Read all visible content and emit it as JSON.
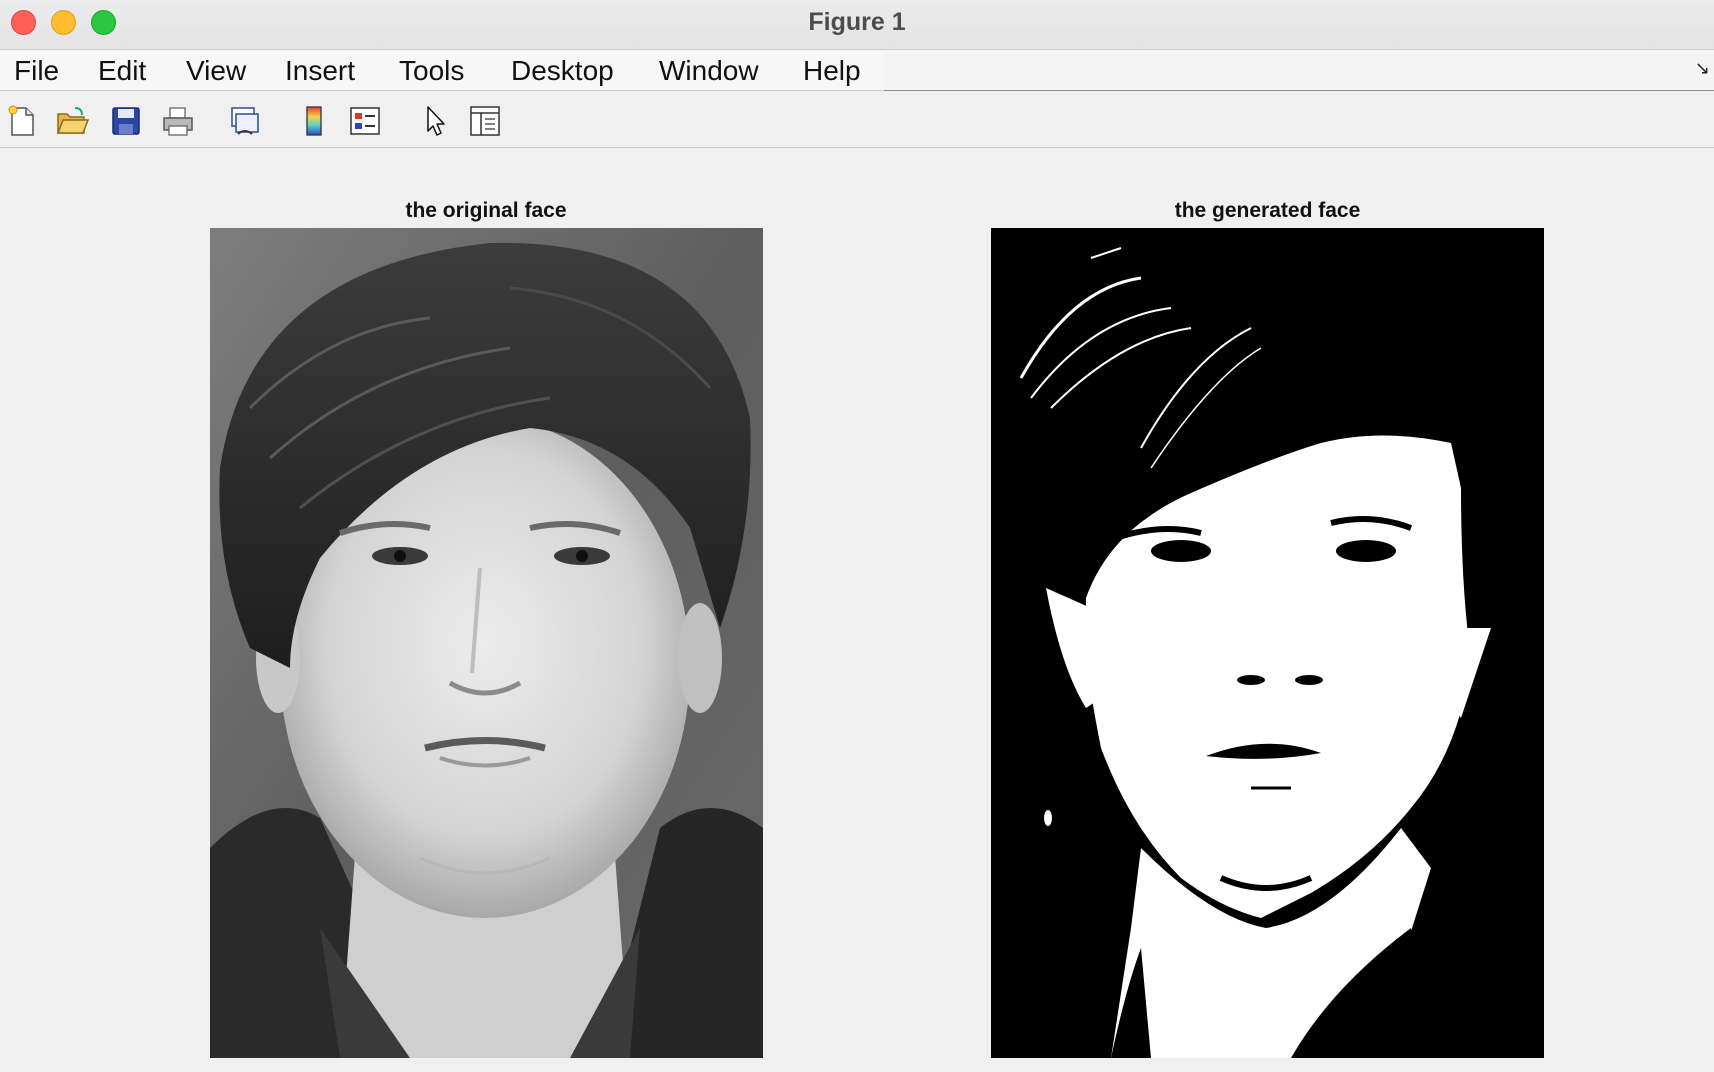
{
  "window": {
    "title": "Figure 1"
  },
  "menu": {
    "items": [
      "File",
      "Edit",
      "View",
      "Insert",
      "Tools",
      "Desktop",
      "Window",
      "Help"
    ]
  },
  "toolbar": {
    "icons": [
      "new-figure-icon",
      "open-file-icon",
      "save-icon",
      "print-icon",
      "link-plot-icon",
      "colorbar-icon",
      "legend-icon",
      "edit-plot-arrow-icon",
      "property-inspector-icon"
    ]
  },
  "axes": [
    {
      "title": "the original face"
    },
    {
      "title": "the generated face"
    }
  ]
}
